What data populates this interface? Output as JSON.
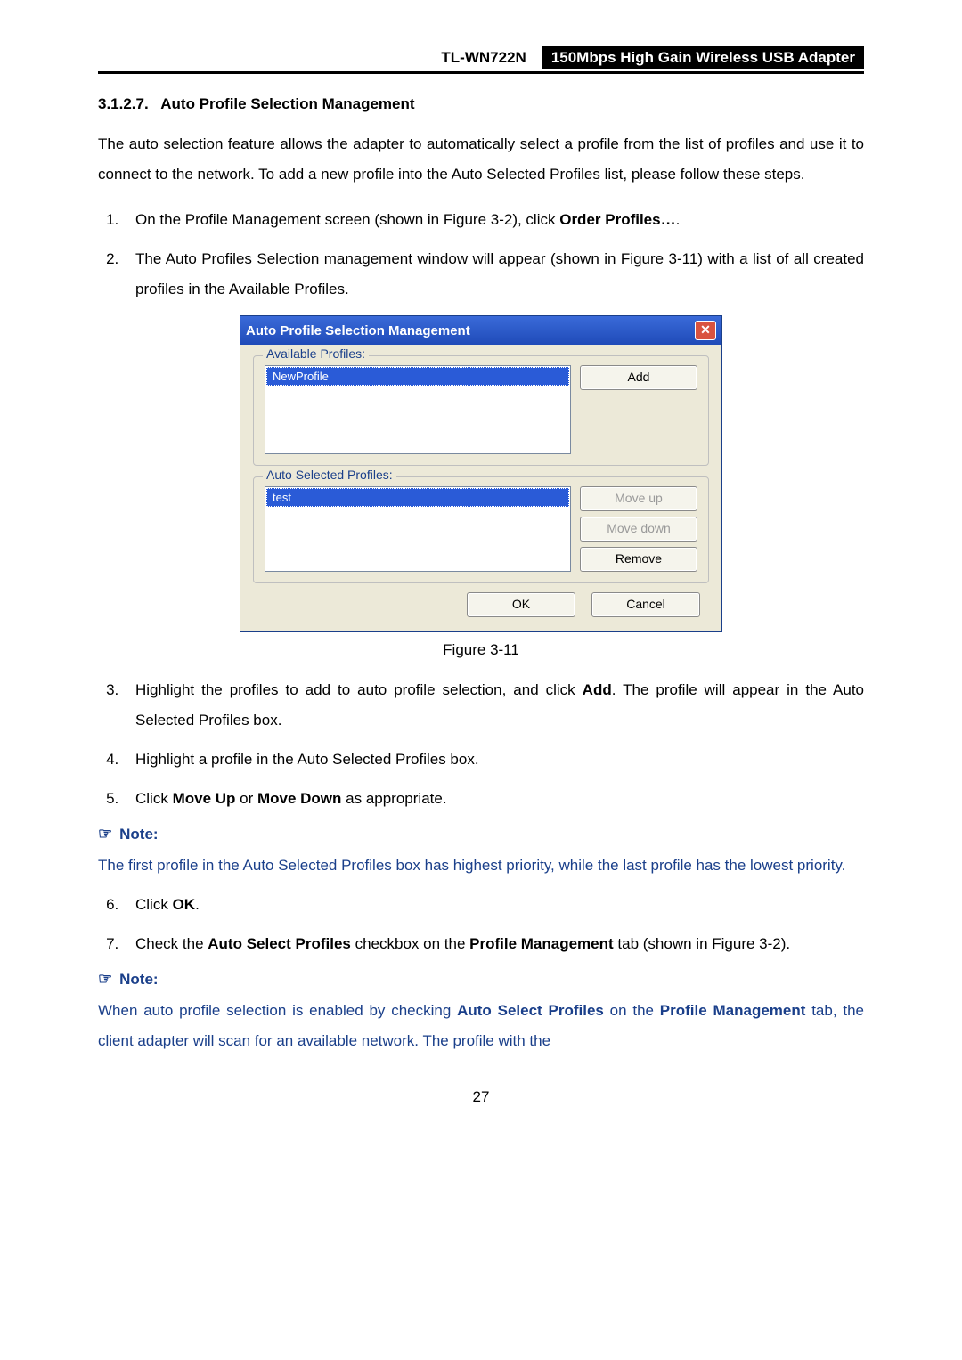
{
  "header": {
    "model": "TL-WN722N",
    "product": "150Mbps High Gain Wireless USB Adapter"
  },
  "section": {
    "number": "3.1.2.7.",
    "title": "Auto Profile Selection Management"
  },
  "intro": "The auto selection feature allows the adapter to automatically select a profile from the list of profiles and use it to connect to the network. To add a new profile into the Auto Selected Profiles list, please follow these steps.",
  "steps1": {
    "s1_a": "On the Profile Management screen (shown in Figure 3-2), click ",
    "s1_b": "Order Profiles…",
    "s1_c": ".",
    "s2": "The Auto Profiles Selection management window will appear (shown in Figure 3-11) with a list of all created profiles in the Available Profiles."
  },
  "dialog": {
    "title": "Auto Profile Selection Management",
    "close": "✕",
    "group1": {
      "legend": "Available Profiles:",
      "item": "NewProfile",
      "add": "Add"
    },
    "group2": {
      "legend": "Auto Selected Profiles:",
      "item": "test",
      "moveup": "Move up",
      "movedown": "Move down",
      "remove": "Remove"
    },
    "ok": "OK",
    "cancel": "Cancel"
  },
  "figcap": "Figure 3-11",
  "steps2": {
    "s3_a": "Highlight the profiles to add to auto profile selection, and click ",
    "s3_b": "Add",
    "s3_c": ". The profile will appear in the Auto Selected Profiles box.",
    "s4": "Highlight a profile in the Auto Selected Profiles box.",
    "s5_a": "Click ",
    "s5_b": "Move Up",
    "s5_c": " or ",
    "s5_d": "Move Down",
    "s5_e": " as appropriate."
  },
  "note1": {
    "label": "Note:",
    "body": "The first profile in the Auto Selected Profiles box has highest priority, while the last profile has the lowest priority."
  },
  "steps3": {
    "s6_a": "Click ",
    "s6_b": "OK",
    "s6_c": ".",
    "s7_a": "Check the ",
    "s7_b": "Auto Select Profiles",
    "s7_c": " checkbox on the ",
    "s7_d": "Profile Management",
    "s7_e": " tab (shown in Figure 3-2)."
  },
  "note2": {
    "label": "Note:",
    "body_a": "When auto profile selection is enabled by checking ",
    "body_b": "Auto Select Profiles",
    "body_c": " on the ",
    "body_d": "Profile Management",
    "body_e": " tab, the client adapter will scan for an available network. The profile with the"
  },
  "pagenum": "27"
}
